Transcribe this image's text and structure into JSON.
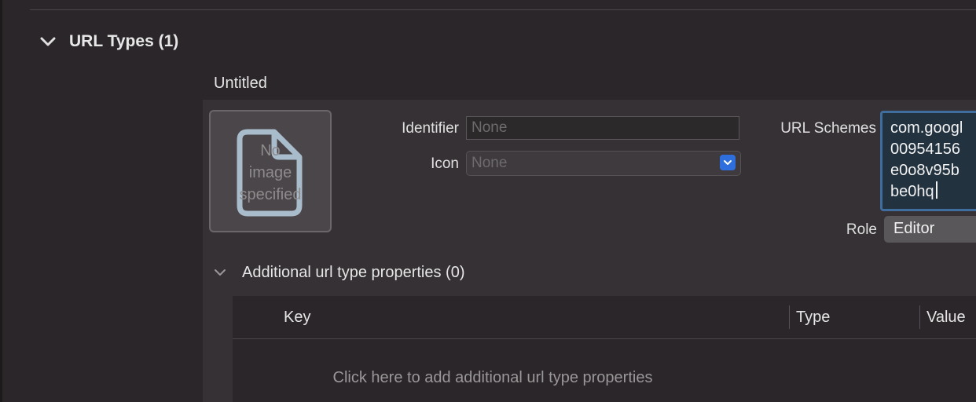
{
  "section": {
    "title": "URL Types (1)",
    "expanded": true
  },
  "entry": {
    "title": "Untitled",
    "image_well": {
      "placeholder_lines": [
        "No",
        "image",
        "specified"
      ],
      "icon": "document-icon"
    },
    "identifier": {
      "label": "Identifier",
      "placeholder": "None",
      "value": ""
    },
    "icon": {
      "label": "Icon",
      "selected": "None"
    },
    "url_schemes": {
      "label": "URL Schemes",
      "lines": [
        "com.googl",
        "00954156",
        "e0o8v95b",
        "be0hq"
      ]
    },
    "role": {
      "label": "Role",
      "selected": "Editor"
    }
  },
  "additional": {
    "title": "Additional url type properties (0)",
    "columns": [
      "Key",
      "Type",
      "Value"
    ],
    "empty_hint": "Click here to add additional url type properties"
  },
  "colors": {
    "accent": "#2f6fdd",
    "selection_border": "#3f6e9e"
  }
}
